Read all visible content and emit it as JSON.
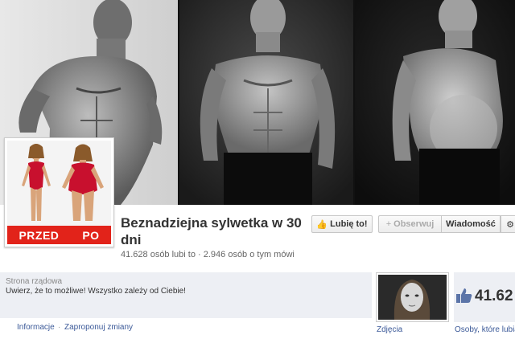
{
  "cover": {
    "panels": [
      {
        "icon": "athlete-photo"
      },
      {
        "icon": "fit-man-photo"
      },
      {
        "icon": "overweight-man-photo"
      }
    ]
  },
  "profile": {
    "banner_before": "PRZED",
    "banner_after": "PO",
    "colors": {
      "banner": "#e2231a",
      "swimsuit": "#c8102e"
    }
  },
  "page": {
    "title": "Beznadziejna sylwetka w 30 dni",
    "stats": "41.628 osób lubi to · 2.946 osób o tym mówi"
  },
  "actions": {
    "like_label": "Lubię to!",
    "follow_label": "Obserwuj",
    "message_label": "Wiadomość",
    "gear_icon": "gear-icon"
  },
  "about": {
    "category": "Strona rządowa",
    "description": "Uwierz, że to możliwe! Wszystko zależy od Ciebie!"
  },
  "tabs": {
    "info": "Informacje",
    "separator": "·",
    "suggest": "Zaproponuj zmiany"
  },
  "photos": {
    "label": "Zdjęcia"
  },
  "likes": {
    "count": "41.62",
    "label": "Osoby, które lubią"
  },
  "colors": {
    "link": "#3b5998",
    "info_bg": "#edeff4"
  }
}
